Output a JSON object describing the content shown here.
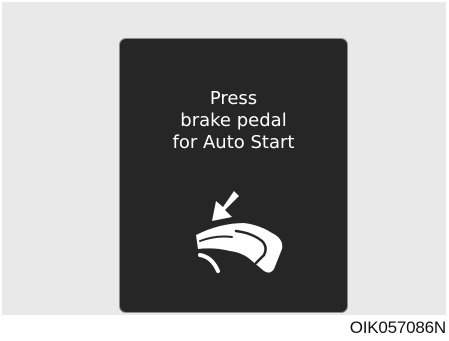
{
  "display": {
    "message_lines": [
      "Press",
      "brake pedal",
      "for Auto Start"
    ],
    "icon": "brake-pedal-foot-icon"
  },
  "figure_code": "OIK057086N",
  "colors": {
    "frame_background": "#e9e9e9",
    "display_background": "#262626",
    "display_text": "#ffffff"
  }
}
